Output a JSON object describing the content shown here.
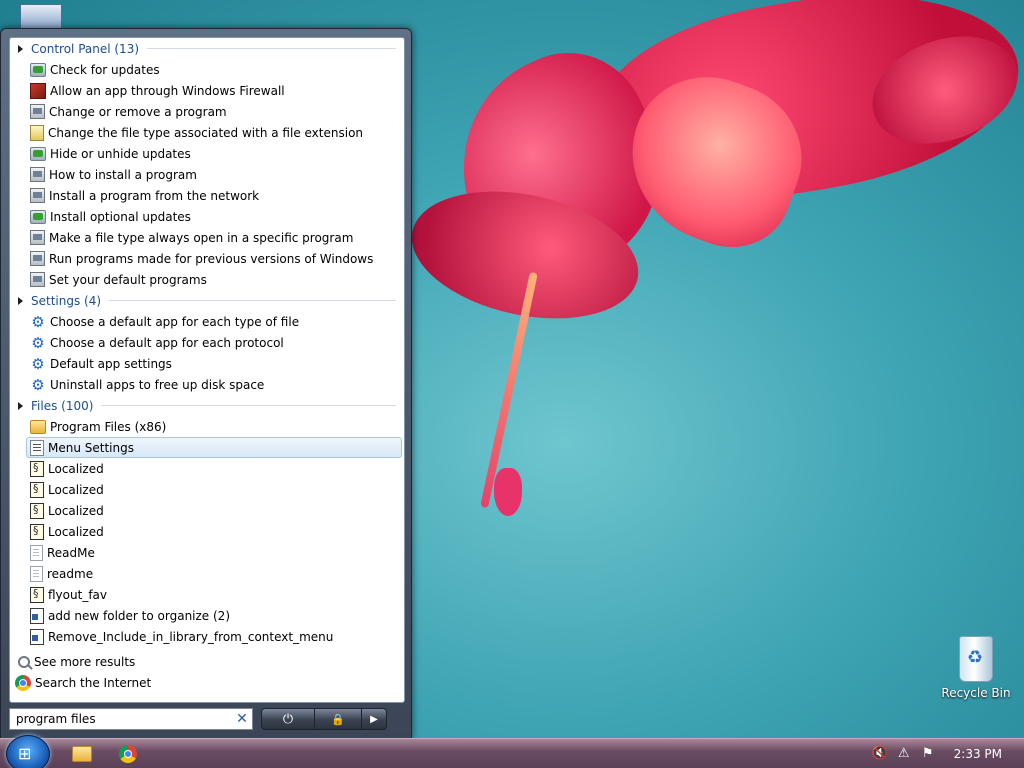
{
  "desktop": {
    "recycle_bin_label": "Recycle Bin"
  },
  "start_menu": {
    "groups": [
      {
        "header": "Control Panel (13)",
        "items": [
          {
            "label": "Check for updates",
            "icon": "windows-update-icon"
          },
          {
            "label": "Allow an app through Windows Firewall",
            "icon": "firewall-icon"
          },
          {
            "label": "Change or remove a program",
            "icon": "programs-icon"
          },
          {
            "label": "Change the file type associated with a file extension",
            "icon": "file-type-icon"
          },
          {
            "label": "Hide or unhide updates",
            "icon": "windows-update-icon"
          },
          {
            "label": "How to install a program",
            "icon": "programs-icon"
          },
          {
            "label": "Install a program from the network",
            "icon": "programs-icon"
          },
          {
            "label": "Install optional updates",
            "icon": "windows-update-icon"
          },
          {
            "label": "Make a file type always open in a specific program",
            "icon": "default-programs-icon"
          },
          {
            "label": "Run programs made for previous versions of Windows",
            "icon": "programs-icon"
          },
          {
            "label": "Set your default programs",
            "icon": "default-programs-icon"
          }
        ]
      },
      {
        "header": "Settings (4)",
        "items": [
          {
            "label": "Choose a default app for each type of file",
            "icon": "gear-icon"
          },
          {
            "label": "Choose a default app for each protocol",
            "icon": "gear-icon"
          },
          {
            "label": "Default app settings",
            "icon": "gear-icon"
          },
          {
            "label": "Uninstall apps to free up disk space",
            "icon": "gear-icon"
          }
        ]
      },
      {
        "header": "Files (100)",
        "items": [
          {
            "label": "Program Files (x86)",
            "icon": "folder-icon"
          },
          {
            "label": "Menu Settings",
            "icon": "config-file-icon",
            "selected": true
          },
          {
            "label": "Localized",
            "icon": "script-file-icon"
          },
          {
            "label": "Localized",
            "icon": "script-file-icon"
          },
          {
            "label": "Localized",
            "icon": "script-file-icon"
          },
          {
            "label": "Localized",
            "icon": "script-file-icon"
          },
          {
            "label": "ReadMe",
            "icon": "text-file-icon"
          },
          {
            "label": "readme",
            "icon": "text-file-icon"
          },
          {
            "label": "flyout_fav",
            "icon": "script-file-icon"
          },
          {
            "label": "add new folder to organize (2)",
            "icon": "registry-file-icon"
          },
          {
            "label": "Remove_Include_in_library_from_context_menu",
            "icon": "registry-file-icon"
          }
        ]
      }
    ],
    "see_more_results": "See more results",
    "search_internet": "Search the Internet",
    "search": {
      "value": "program files",
      "clear_glyph": "✕"
    },
    "power": {
      "shutdown_glyph": "⏻",
      "lock_glyph": "🔒",
      "arrow_glyph": "▶"
    }
  },
  "taskbar": {
    "start_glyph": "⊞",
    "pinned": [
      "File Explorer",
      "Google Chrome"
    ],
    "tray": {
      "clock": "2:33 PM",
      "volume_glyph": "🔇",
      "network_glyph": "⚠",
      "action_center_glyph": "⚑"
    }
  },
  "colors": {
    "group_header": "#1e4d8c",
    "selection": "#d8e8f8",
    "taskbar": "#6a4d63"
  }
}
